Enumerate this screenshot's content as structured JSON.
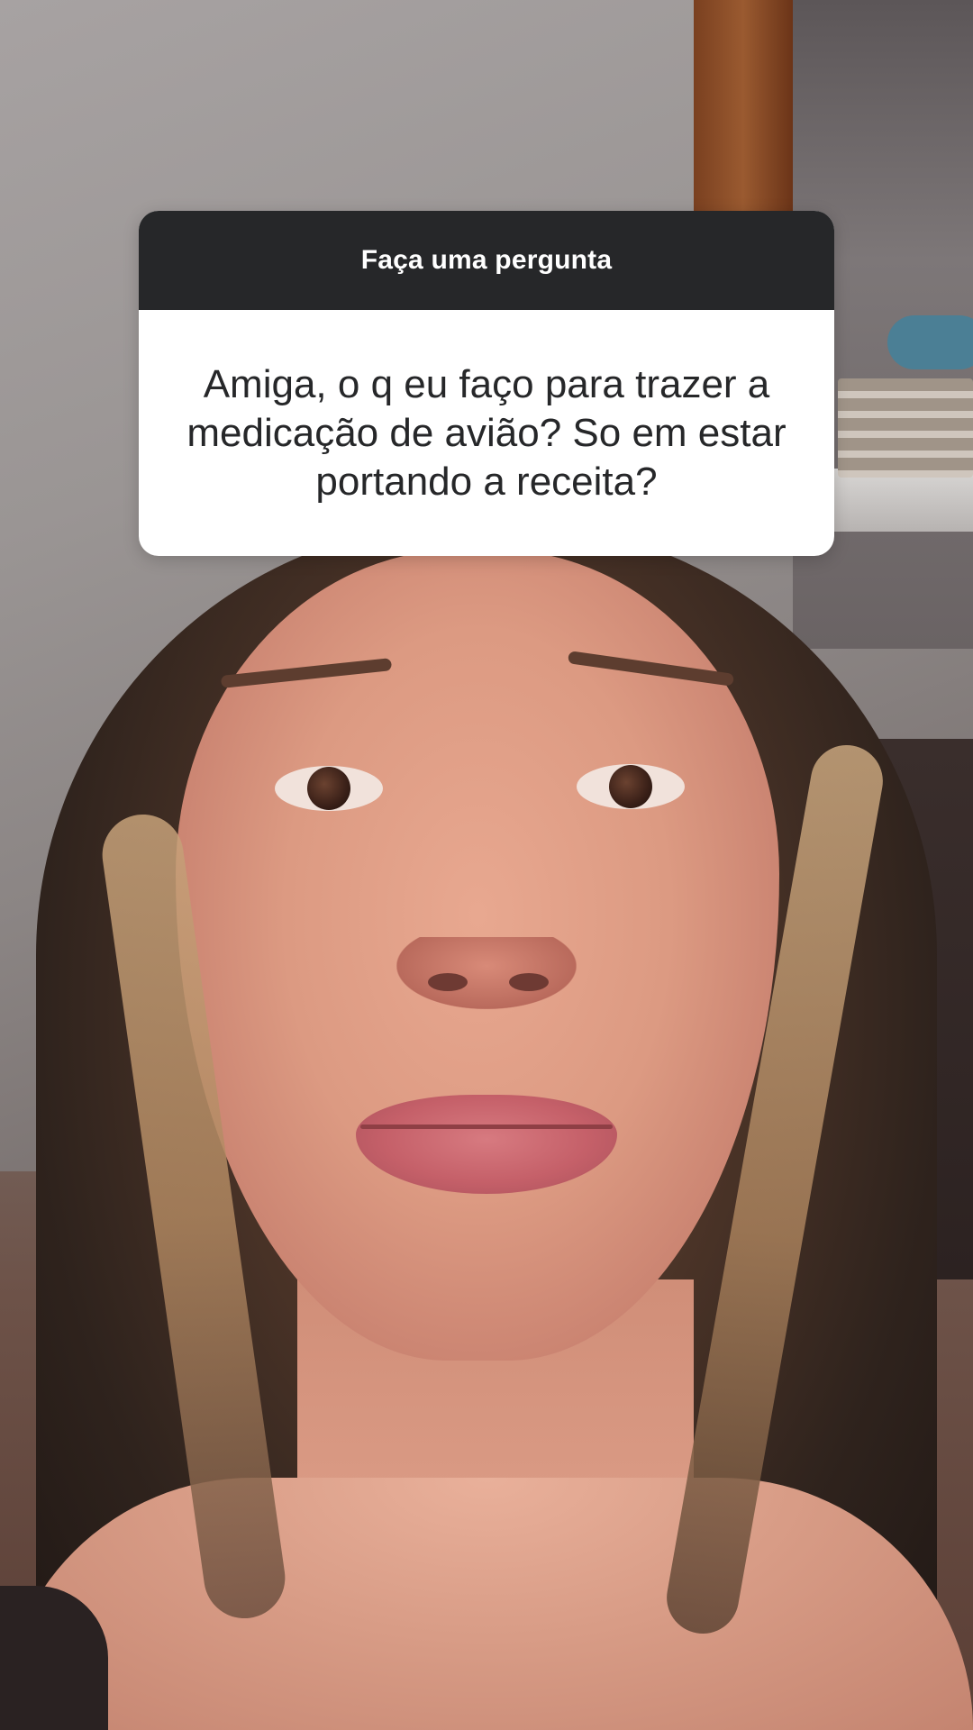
{
  "question_sticker": {
    "title": "Faça uma pergunta",
    "question": "Amiga, o q eu faço para trazer a medicação de avião? So em estar portando a receita?",
    "header_color": "#262729",
    "body_color": "#ffffff",
    "text_color": "#262729"
  }
}
